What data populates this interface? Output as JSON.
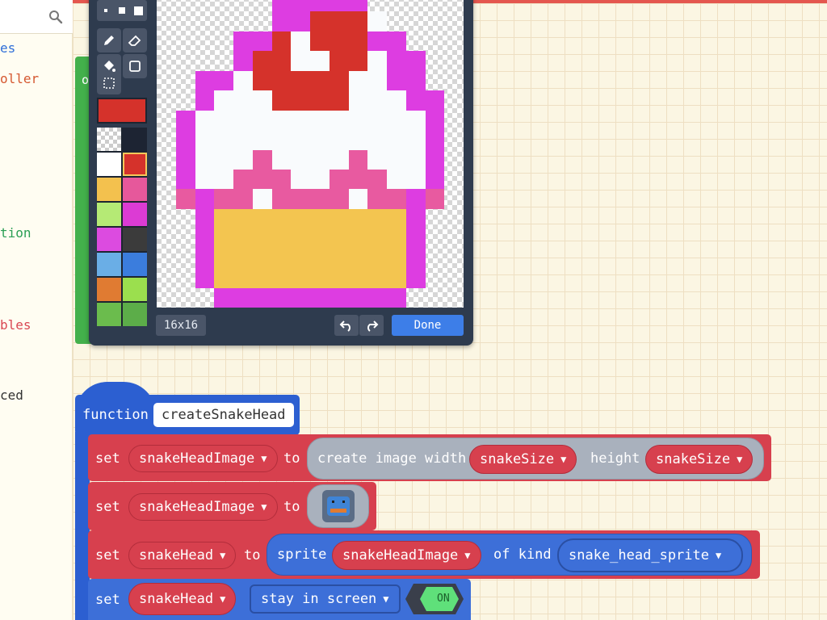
{
  "toolbox": {
    "search_placeholder": "",
    "categories": [
      {
        "label": "es",
        "color": "#2f6ed8"
      },
      {
        "label": "oller",
        "color": "#d55830"
      },
      {
        "label": "tion",
        "color": "#2b9f55"
      },
      {
        "label": "bles",
        "color": "#d94752"
      },
      {
        "label": "ced",
        "color": "#333333"
      }
    ]
  },
  "green_block": {
    "label": "o"
  },
  "image_editor": {
    "current_color": "#d5322b",
    "size_label": "16x16",
    "done_label": "Done",
    "palette": [
      "transparent",
      "#1d2433",
      "#ffffff",
      "#d5322b",
      "#f3c14e",
      "#e6589b",
      "#b5ea75",
      "#dc3bd4",
      "#dc4be0",
      "#3b3b3b",
      "#6aaee6",
      "#3b7ddd",
      "#e07b32",
      "#9bdf4e",
      "#6bbc4d",
      "#5cad49"
    ],
    "selected_swatch": 3,
    "pixels": [
      "......MMMMM.....",
      "......MMRRRW....",
      "....MMRWRRRMM...",
      "....MRRWWRRWMM..",
      "..MMWRRRRRWWMM..",
      "..MWWWRRRRWWWMM.",
      ".MWWWWWWWWWWWWM.",
      ".MWWWWWWWWWWWWM.",
      ".MWWWPWWWWPWWWM.",
      ".MWWPPPWWPPPWWM.",
      ".PMPPWPPPPWPPMP.",
      "..MYYYYYYYYYYM..",
      "..MYYYYYYYYYYM..",
      "..MYYYYYYYYYYM..",
      "..MYYYYYYYYYYM..",
      "...MMMMMMMMMM..."
    ],
    "colors": {
      "M": "#dd3de1",
      "R": "#d5322b",
      "W": "#f9fbfd",
      "P": "#e85aa0",
      "Y": "#f3c550"
    }
  },
  "blocks": {
    "function_keyword": "function",
    "function_name": "createSnakeHead",
    "set": "set",
    "to": "to",
    "row1": {
      "var": "snakeHeadImage",
      "create_text": "create image width",
      "width_var": "snakeSize",
      "height_text": "height",
      "height_var": "snakeSize"
    },
    "row2": {
      "var": "snakeHeadImage"
    },
    "row3": {
      "var": "snakeHead",
      "sprite_text": "sprite",
      "image_var": "snakeHeadImage",
      "of_kind_text": "of kind",
      "kind": "snake_head_sprite"
    },
    "row4": {
      "var": "snakeHead",
      "flag": "stay in screen",
      "toggle": "ON"
    }
  }
}
